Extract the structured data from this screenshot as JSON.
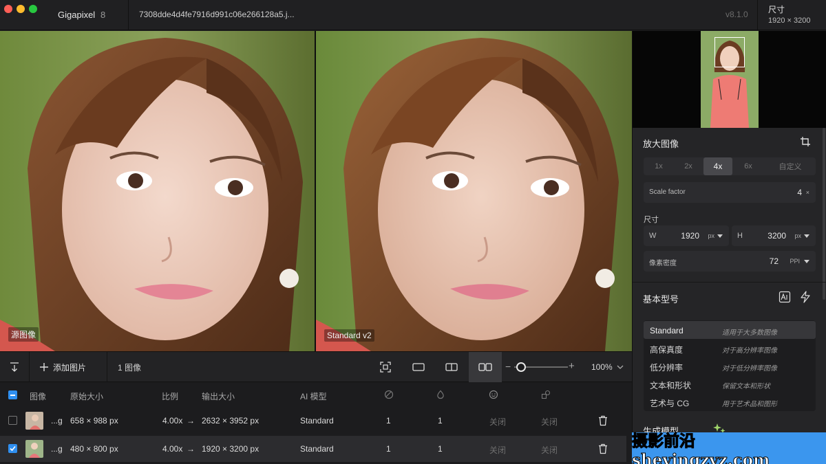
{
  "titlebar": {
    "app_name": "Gigapixel",
    "app_version": "8",
    "file_name": "7308dde4d4fe7916d991c06e266128a5.j...",
    "build_version": "v8.1.0",
    "size_label": "尺寸",
    "size_value": "1920 × 3200"
  },
  "panels": {
    "left_label": "源图像",
    "right_label": "Standard v2"
  },
  "toolbar": {
    "add_label": "添加图片",
    "count_label": "1 图像",
    "zoom_value": "100%",
    "zoom_level": 0.08
  },
  "table": {
    "headers": {
      "image": "图像",
      "original_size": "原始大小",
      "ratio": "比例",
      "output_size": "输出大小",
      "ai_model": "AI 模型"
    },
    "rows": [
      {
        "name": "...g",
        "original": "658 × 988 px",
        "ratio": "4.00x",
        "arrow": "→",
        "output": "2632 × 3952 px",
        "model": "Standard",
        "col1": "1",
        "col2": "1",
        "col3": "关闭",
        "col4": "关闭",
        "checked": false
      },
      {
        "name": "...g",
        "original": "480 × 800 px",
        "ratio": "4.00x",
        "arrow": "→",
        "output": "1920 × 3200 px",
        "model": "Standard",
        "col1": "1",
        "col2": "1",
        "col3": "关闭",
        "col4": "关闭",
        "checked": true
      }
    ]
  },
  "sidebar": {
    "enlarge_title": "放大图像",
    "scale_options": [
      "1x",
      "2x",
      "4x",
      "6x",
      "自定义"
    ],
    "scale_active": "4x",
    "scale_factor_label": "Scale factor",
    "scale_factor_value": "4",
    "scale_factor_unit": "×",
    "dimension_label": "尺寸",
    "width_label": "W",
    "width_value": "1920",
    "width_unit": "px",
    "height_label": "H",
    "height_value": "3200",
    "height_unit": "px",
    "ppi_label": "像素密度",
    "ppi_value": "72",
    "ppi_unit": "PPI",
    "base_model_title": "基本型号",
    "models": [
      {
        "name": "Standard",
        "desc": "适用于大多数图像"
      },
      {
        "name": "高保真度",
        "desc": "对于高分辨率图像"
      },
      {
        "name": "低分辨率",
        "desc": "对于低分辨率图像"
      },
      {
        "name": "文本和形状",
        "desc": "保留文本和形状"
      },
      {
        "name": "艺术与 CG",
        "desc": "用于艺术品和图形"
      }
    ],
    "active_model": "Standard",
    "gen_model_title": "生成模型"
  },
  "watermark": {
    "text": "摄影前沿 sheyingzyz.com"
  },
  "colors": {
    "accent": "#2f8ff0",
    "banner": "#3b96ee"
  }
}
